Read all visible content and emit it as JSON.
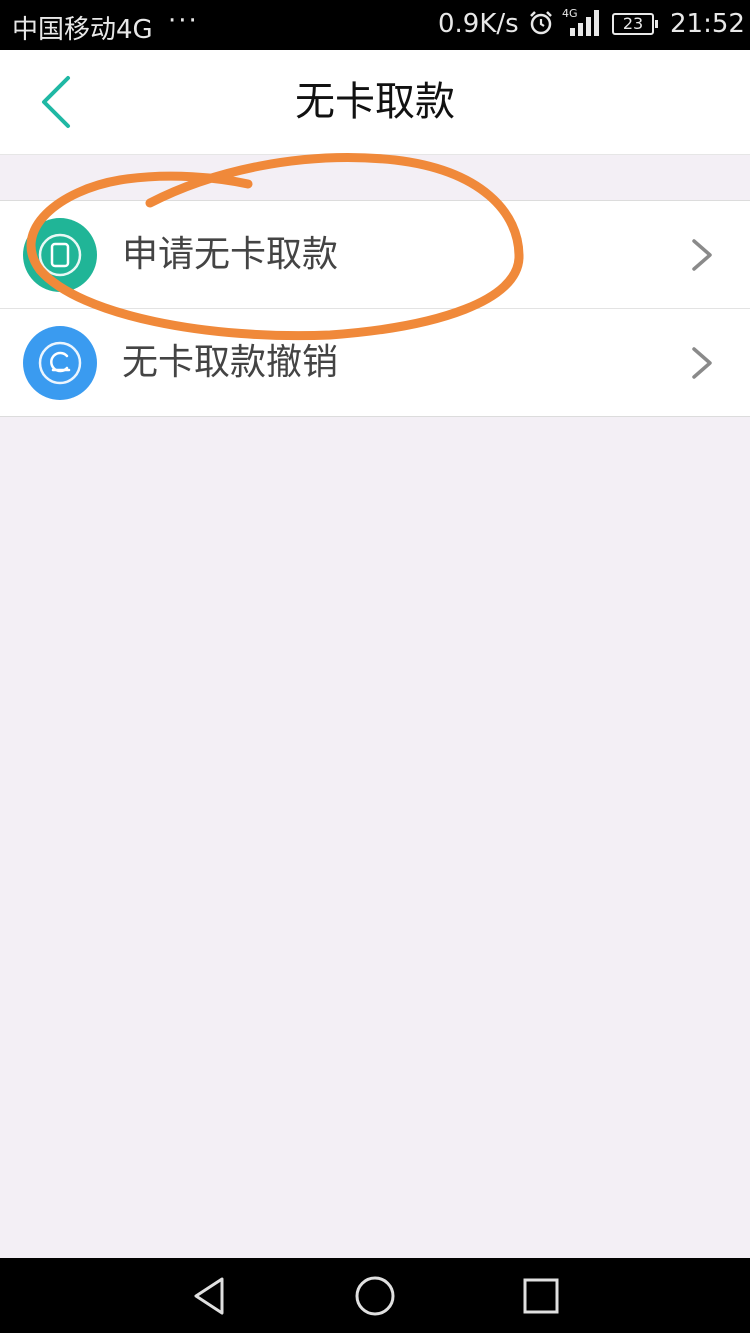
{
  "status_bar": {
    "carrier": "中国移动4G",
    "dots": "···",
    "net_speed": "0.9K/s",
    "network_type": "4G",
    "battery": "23",
    "time": "21:52",
    "icons": [
      "alarm-icon",
      "signal-icon",
      "battery-icon"
    ]
  },
  "header": {
    "title": "无卡取款",
    "back_icon": "chevron-left-icon"
  },
  "menu": {
    "items": [
      {
        "label": "申请无卡取款",
        "icon": "phone-card-icon",
        "icon_color": "#20b597"
      },
      {
        "label": "无卡取款撤销",
        "icon": "undo-icon",
        "icon_color": "#3a9bf0"
      }
    ]
  },
  "annotation": {
    "color": "#f0893a",
    "shape": "hand-drawn circle around first menu item"
  },
  "nav_bar": {
    "icons": [
      "back-triangle-icon",
      "home-circle-icon",
      "recents-square-icon"
    ]
  },
  "colors": {
    "accent": "#1fb8a4",
    "background": "#f3eff5",
    "text": "#444444"
  }
}
